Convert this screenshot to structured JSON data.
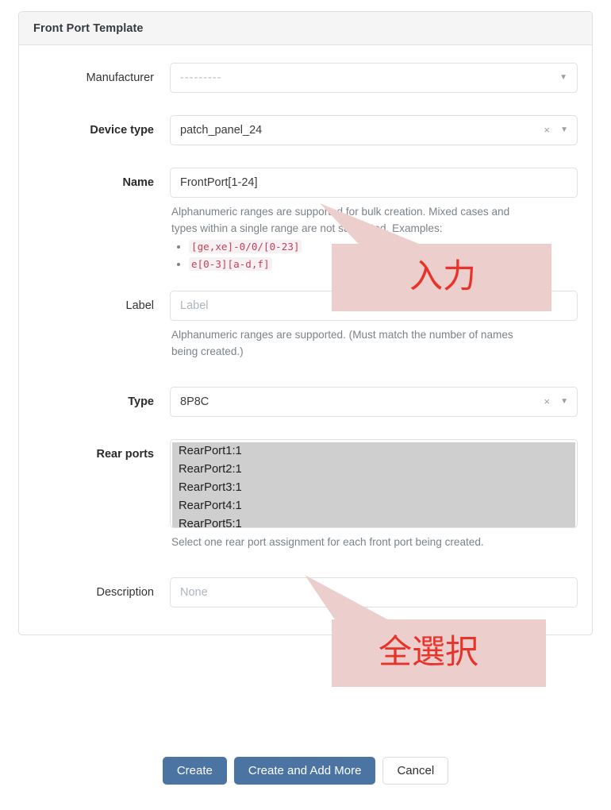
{
  "card": {
    "title": "Front Port Template"
  },
  "fields": {
    "manufacturer": {
      "label": "Manufacturer",
      "required": false,
      "value": "---------",
      "clear_icon": "",
      "caret_icon": "▼"
    },
    "device_type": {
      "label": "Device type",
      "required": true,
      "value": "patch_panel_24",
      "clear_icon": "×",
      "caret_icon": "▼"
    },
    "name": {
      "label": "Name",
      "required": true,
      "value": "FrontPort[1-24]",
      "help_line1": "Alphanumeric ranges are supported for bulk creation.",
      "help_line2": "Mixed cases and types within a single range are not",
      "help_line3": "supported. Examples:",
      "examples": [
        "[ge,xe]-0/0/[0-23]",
        "e[0-3][a-d,f]"
      ]
    },
    "label": {
      "label": "Label",
      "required": false,
      "placeholder": "Label",
      "help": "Alphanumeric ranges are supported. (Must match the number of names being created.)"
    },
    "type": {
      "label": "Type",
      "required": true,
      "value": "8P8C",
      "clear_icon": "×",
      "caret_icon": "▼"
    },
    "rear_ports": {
      "label": "Rear ports",
      "required": true,
      "options": [
        "RearPort1:1",
        "RearPort2:1",
        "RearPort3:1",
        "RearPort4:1",
        "RearPort5:1"
      ],
      "help": "Select one rear port assignment for each front port being created."
    },
    "description": {
      "label": "Description",
      "required": false,
      "placeholder": "None"
    }
  },
  "buttons": {
    "create": "Create",
    "create_and_add_more": "Create and Add More",
    "cancel": "Cancel"
  },
  "annotations": {
    "input": "入力",
    "select_all": "全選択"
  },
  "colors": {
    "primary": "#4c74a3",
    "annotation_bg": "#eccfcd",
    "annotation_text": "#e8322a",
    "selected_option_bg": "#cfcfcf",
    "code_text": "#c7405c"
  }
}
